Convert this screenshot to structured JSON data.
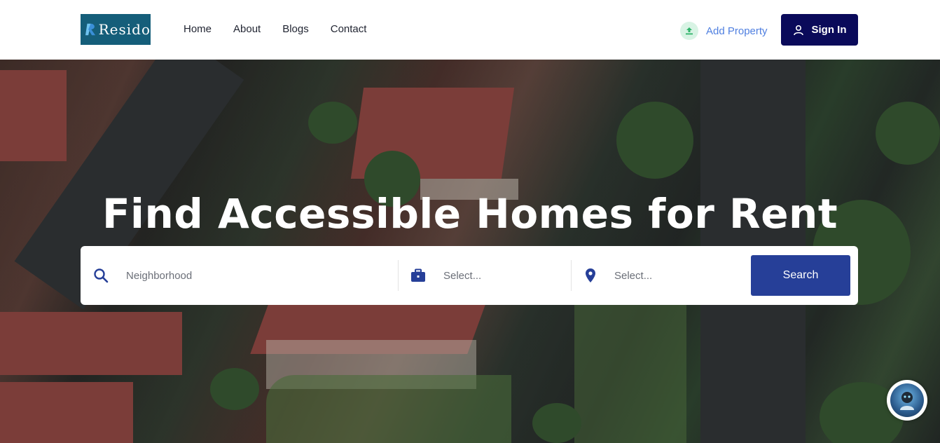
{
  "brand": {
    "name": "Resido"
  },
  "nav": {
    "items": [
      "Home",
      "About",
      "Blogs",
      "Contact"
    ]
  },
  "header": {
    "add_property": "Add Property",
    "sign_in": "Sign In"
  },
  "hero": {
    "title": "Find Accessible Homes for Rent"
  },
  "search": {
    "neighborhood_placeholder": "Neighborhood",
    "type_placeholder": "Select...",
    "location_placeholder": "Select...",
    "button": "Search"
  },
  "colors": {
    "brand": "#155e7a",
    "signin": "#0a0a5a",
    "search_button": "#263f98",
    "accent_link": "#4f7fe0"
  },
  "icons": [
    "search-icon",
    "briefcase-icon",
    "map-pin-icon",
    "user-icon",
    "upload-icon",
    "chat-assistant-icon"
  ]
}
